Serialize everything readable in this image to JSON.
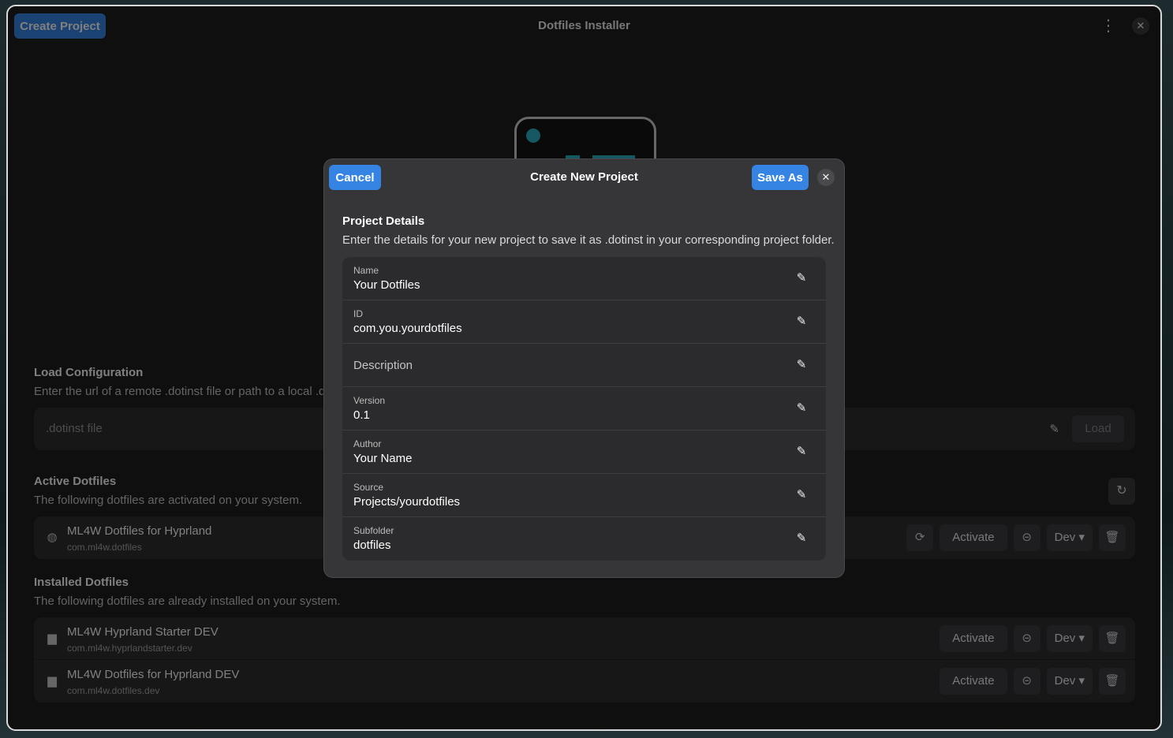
{
  "window": {
    "title": "Dotfiles Installer",
    "create_project_label": "Create Project"
  },
  "load_config": {
    "title": "Load Configuration",
    "subtitle": "Enter the url of a remote .dotinst file or path to a local .do",
    "input_placeholder": ".dotinst file",
    "load_label": "Load"
  },
  "active": {
    "title": "Active Dotfiles",
    "subtitle": "The following dotfiles are activated on your system.",
    "items": [
      {
        "name": "ML4W Dotfiles for Hyprland",
        "id": "com.ml4w.dotfiles",
        "icon": "globe-icon"
      }
    ]
  },
  "installed": {
    "title": "Installed Dotfiles",
    "subtitle": "The following dotfiles are already installed on your system.",
    "items": [
      {
        "name": "ML4W Hyprland Starter DEV",
        "id": "com.ml4w.hyprlandstarter.dev",
        "icon": "folder-icon"
      },
      {
        "name": "ML4W Dotfiles for Hyprland DEV",
        "id": "com.ml4w.dotfiles.dev",
        "icon": "folder-icon"
      }
    ]
  },
  "row_actions": {
    "activate_label": "Activate",
    "profile_label": "Dev"
  },
  "dialog": {
    "title": "Create New Project",
    "cancel_label": "Cancel",
    "save_label": "Save As",
    "heading": "Project Details",
    "description": "Enter the details for your new project to save it as .dotinst in your corresponding project folder.",
    "fields": [
      {
        "label": "Name",
        "value": "Your Dotfiles"
      },
      {
        "label": "ID",
        "value": "com.you.yourdotfiles"
      },
      {
        "label": "",
        "placeholder": "Description",
        "value": ""
      },
      {
        "label": "Version",
        "value": "0.1"
      },
      {
        "label": "Author",
        "value": "Your Name"
      },
      {
        "label": "Source",
        "value": "Projects/yourdotfiles"
      },
      {
        "label": "Subfolder",
        "value": "dotfiles"
      }
    ]
  },
  "colors": {
    "accent": "#3584e4",
    "window_bg": "#1e1e20",
    "card_bg": "#2f2f31",
    "dialog_bg": "#363638"
  }
}
